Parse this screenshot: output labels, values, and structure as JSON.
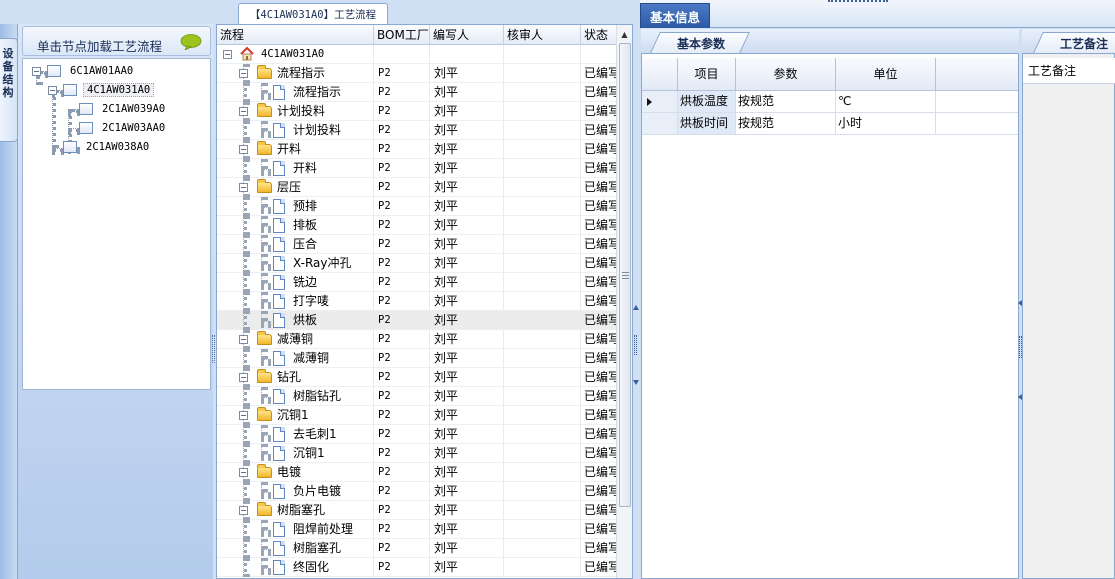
{
  "left": {
    "vertical_tab": "设备结构",
    "header": "单击节点加载工艺流程",
    "tree": [
      {
        "label": "6C1AW01AA0",
        "level": 0
      },
      {
        "label": "4C1AW031A0",
        "level": 1,
        "selected": true
      },
      {
        "label": "2C1AW039A0",
        "level": 2
      },
      {
        "label": "2C1AW03AA0",
        "level": 2
      },
      {
        "label": "2C1AW038A0",
        "level": 1
      }
    ]
  },
  "middle": {
    "tab_title": "【4C1AW031A0】工艺流程",
    "columns": [
      "流程",
      "BOM工厂",
      "编写人",
      "核审人",
      "状态"
    ],
    "root": "4C1AW031A0",
    "rows": [
      {
        "name": "流程指示",
        "type": "folder",
        "bom": "P2",
        "writer": "刘平",
        "reviewer": "",
        "status": "已编写"
      },
      {
        "name": "流程指示",
        "type": "doc",
        "bom": "P2",
        "writer": "刘平",
        "reviewer": "",
        "status": "已编写"
      },
      {
        "name": "计划投料",
        "type": "folder",
        "bom": "P2",
        "writer": "刘平",
        "reviewer": "",
        "status": "已编写"
      },
      {
        "name": "计划投料",
        "type": "doc",
        "bom": "P2",
        "writer": "刘平",
        "reviewer": "",
        "status": "已编写"
      },
      {
        "name": "开料",
        "type": "folder",
        "bom": "P2",
        "writer": "刘平",
        "reviewer": "",
        "status": "已编写"
      },
      {
        "name": "开料",
        "type": "doc",
        "bom": "P2",
        "writer": "刘平",
        "reviewer": "",
        "status": "已编写"
      },
      {
        "name": "层压",
        "type": "folder",
        "bom": "P2",
        "writer": "刘平",
        "reviewer": "",
        "status": "已编写"
      },
      {
        "name": "预排",
        "type": "doc",
        "bom": "P2",
        "writer": "刘平",
        "reviewer": "",
        "status": "已编写"
      },
      {
        "name": "排板",
        "type": "doc",
        "bom": "P2",
        "writer": "刘平",
        "reviewer": "",
        "status": "已编写"
      },
      {
        "name": "压合",
        "type": "doc",
        "bom": "P2",
        "writer": "刘平",
        "reviewer": "",
        "status": "已编写"
      },
      {
        "name": "X-Ray冲孔",
        "type": "doc",
        "bom": "P2",
        "writer": "刘平",
        "reviewer": "",
        "status": "已编写"
      },
      {
        "name": "铣边",
        "type": "doc",
        "bom": "P2",
        "writer": "刘平",
        "reviewer": "",
        "status": "已编写"
      },
      {
        "name": "打字唛",
        "type": "doc",
        "bom": "P2",
        "writer": "刘平",
        "reviewer": "",
        "status": "已编写"
      },
      {
        "name": "烘板",
        "type": "doc",
        "bom": "P2",
        "writer": "刘平",
        "reviewer": "",
        "status": "已编写",
        "selected": true
      },
      {
        "name": "减薄铜",
        "type": "folder",
        "bom": "P2",
        "writer": "刘平",
        "reviewer": "",
        "status": "已编写"
      },
      {
        "name": "减薄铜",
        "type": "doc",
        "bom": "P2",
        "writer": "刘平",
        "reviewer": "",
        "status": "已编写"
      },
      {
        "name": "钻孔",
        "type": "folder",
        "bom": "P2",
        "writer": "刘平",
        "reviewer": "",
        "status": "已编写"
      },
      {
        "name": "树脂钻孔",
        "type": "doc",
        "bom": "P2",
        "writer": "刘平",
        "reviewer": "",
        "status": "已编写"
      },
      {
        "name": "沉铜1",
        "type": "folder",
        "bom": "P2",
        "writer": "刘平",
        "reviewer": "",
        "status": "已编写"
      },
      {
        "name": "去毛刺1",
        "type": "doc",
        "bom": "P2",
        "writer": "刘平",
        "reviewer": "",
        "status": "已编写"
      },
      {
        "name": "沉铜1",
        "type": "doc",
        "bom": "P2",
        "writer": "刘平",
        "reviewer": "",
        "status": "已编写"
      },
      {
        "name": "电镀",
        "type": "folder",
        "bom": "P2",
        "writer": "刘平",
        "reviewer": "",
        "status": "已编写"
      },
      {
        "name": "负片电镀",
        "type": "doc",
        "bom": "P2",
        "writer": "刘平",
        "reviewer": "",
        "status": "已编写"
      },
      {
        "name": "树脂塞孔",
        "type": "folder",
        "bom": "P2",
        "writer": "刘平",
        "reviewer": "",
        "status": "已编写"
      },
      {
        "name": "阻焊前处理",
        "type": "doc",
        "bom": "P2",
        "writer": "刘平",
        "reviewer": "",
        "status": "已编写"
      },
      {
        "name": "树脂塞孔",
        "type": "doc",
        "bom": "P2",
        "writer": "刘平",
        "reviewer": "",
        "status": "已编写"
      },
      {
        "name": "终固化",
        "type": "doc",
        "bom": "P2",
        "writer": "刘平",
        "reviewer": "",
        "status": "已编写"
      }
    ]
  },
  "right": {
    "main_tab": "基本信息",
    "sub_tab": "基本参数",
    "param_columns": [
      "项目",
      "参数",
      "单位"
    ],
    "params": [
      {
        "item": "烘板温度",
        "value": "按规范",
        "unit": "℃"
      },
      {
        "item": "烘板时间",
        "value": "按规范",
        "unit": "小时"
      }
    ],
    "notes_tab": "工艺备注",
    "notes_label": "工艺备注"
  },
  "colors": {
    "accent": "#2c5aa5",
    "panel_bg": "#cfe0f4",
    "folder": "#f2b62a"
  }
}
